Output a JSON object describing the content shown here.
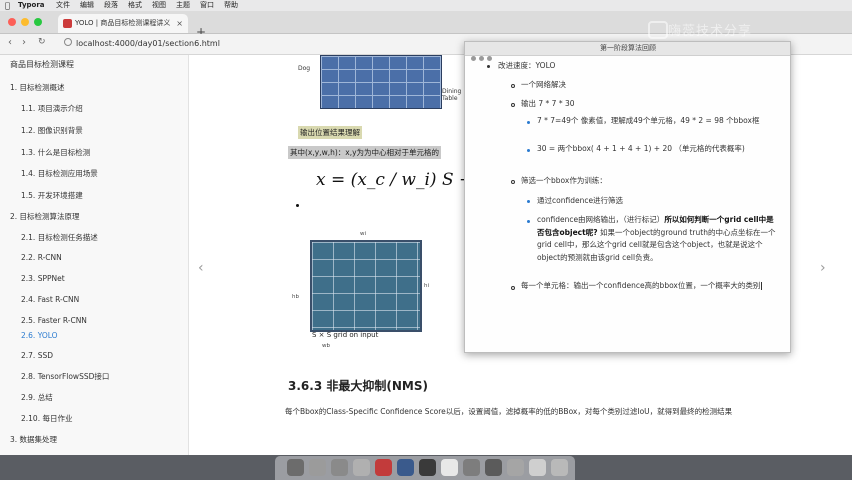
{
  "menubar": {
    "app": "Typora",
    "items": [
      "文件",
      "编辑",
      "段落",
      "格式",
      "视图",
      "主题",
      "窗口",
      "帮助"
    ]
  },
  "browser": {
    "tab_title": "YOLO | 商品目标检测课程讲义",
    "url": "localhost:4000/day01/section6.html"
  },
  "sidebar": {
    "title": "商品目标检测课程",
    "items": [
      {
        "label": "1. 目标检测概述",
        "level": 0
      },
      {
        "label": "1.1. 项目演示介绍",
        "level": 1
      },
      {
        "label": "1.2. 图像识别背景",
        "level": 1
      },
      {
        "label": "1.3. 什么是目标检测",
        "level": 1
      },
      {
        "label": "1.4. 目标检测应用场景",
        "level": 1
      },
      {
        "label": "1.5. 开发环境搭建",
        "level": 1
      },
      {
        "label": "2. 目标检测算法原理",
        "level": 0
      },
      {
        "label": "2.1. 目标检测任务描述",
        "level": 1
      },
      {
        "label": "2.2. R-CNN",
        "level": 1
      },
      {
        "label": "2.3. SPPNet",
        "level": 1
      },
      {
        "label": "2.4. Fast R-CNN",
        "level": 1
      },
      {
        "label": "2.5. Faster R-CNN",
        "level": 1
      },
      {
        "label": "2.6. YOLO",
        "level": 1,
        "active": true
      },
      {
        "label": "2.7. SSD",
        "level": 1
      },
      {
        "label": "2.8. TensorFlowSSD接口",
        "level": 1
      },
      {
        "label": "2.9. 总结",
        "level": 1
      },
      {
        "label": "2.10. 每日作业",
        "level": 1
      },
      {
        "label": "3. 数据集处理",
        "level": 0
      }
    ]
  },
  "main": {
    "image_labels": {
      "dog": "Dog",
      "dining": "Dining Table"
    },
    "bullet_heading": "输出位置结果理解",
    "highlight_line": "其中(x,y,w,h)：x,y为为中心相对于单元格的",
    "formula": "x = (x_c / w_i) S − x_col , y =",
    "photo_labels": {
      "wi": "wi",
      "hb": "hb",
      "hi": "hi",
      "wb": "wb"
    },
    "grid_caption": "S × S grid on input",
    "section_heading": "3.6.3 非最大抑制(NMS)",
    "paragraph": "每个Bbox的Class-Specific Confidence Score以后，设置阈值，滤掉概率的低的BBox，对每个类别过滤IoU，就得到最终的检测结果"
  },
  "note_window": {
    "title": "第一阶段算法回顾",
    "lines": {
      "l1": "改进速度：YOLO",
      "l2": "一个网络解决",
      "l3": "输出 7 * 7 * 30",
      "l4": "7 * 7=49个 像素值，理解成49个单元格，49 * 2 = 98 个bbox框",
      "l5": "30 = 两个bbox( 4 + 1 + 4 + 1) + 20 （单元格的代表概率)",
      "l6": "筛选一个bbox作为训练：",
      "l7": "通过confidence进行筛选",
      "l8a": "confidence由网络输出，（进行标记）",
      "l8b": "所以如何判断一个grid cell中是否包含object呢?",
      "l8c": " 如果一个object的ground truth的中心点坐标在一个grid cell中，那么这个grid cell就是包含这个object，也就是说这个object的预测就由该grid cell负责。",
      "l9": "每一个单元格：输出一个confidence高的bbox位置，一个概率大的类别"
    }
  },
  "watermark": "嗨蕊技术分享",
  "colors": {
    "accent": "#2b7bd0",
    "highlight": "#d9d9b0"
  }
}
